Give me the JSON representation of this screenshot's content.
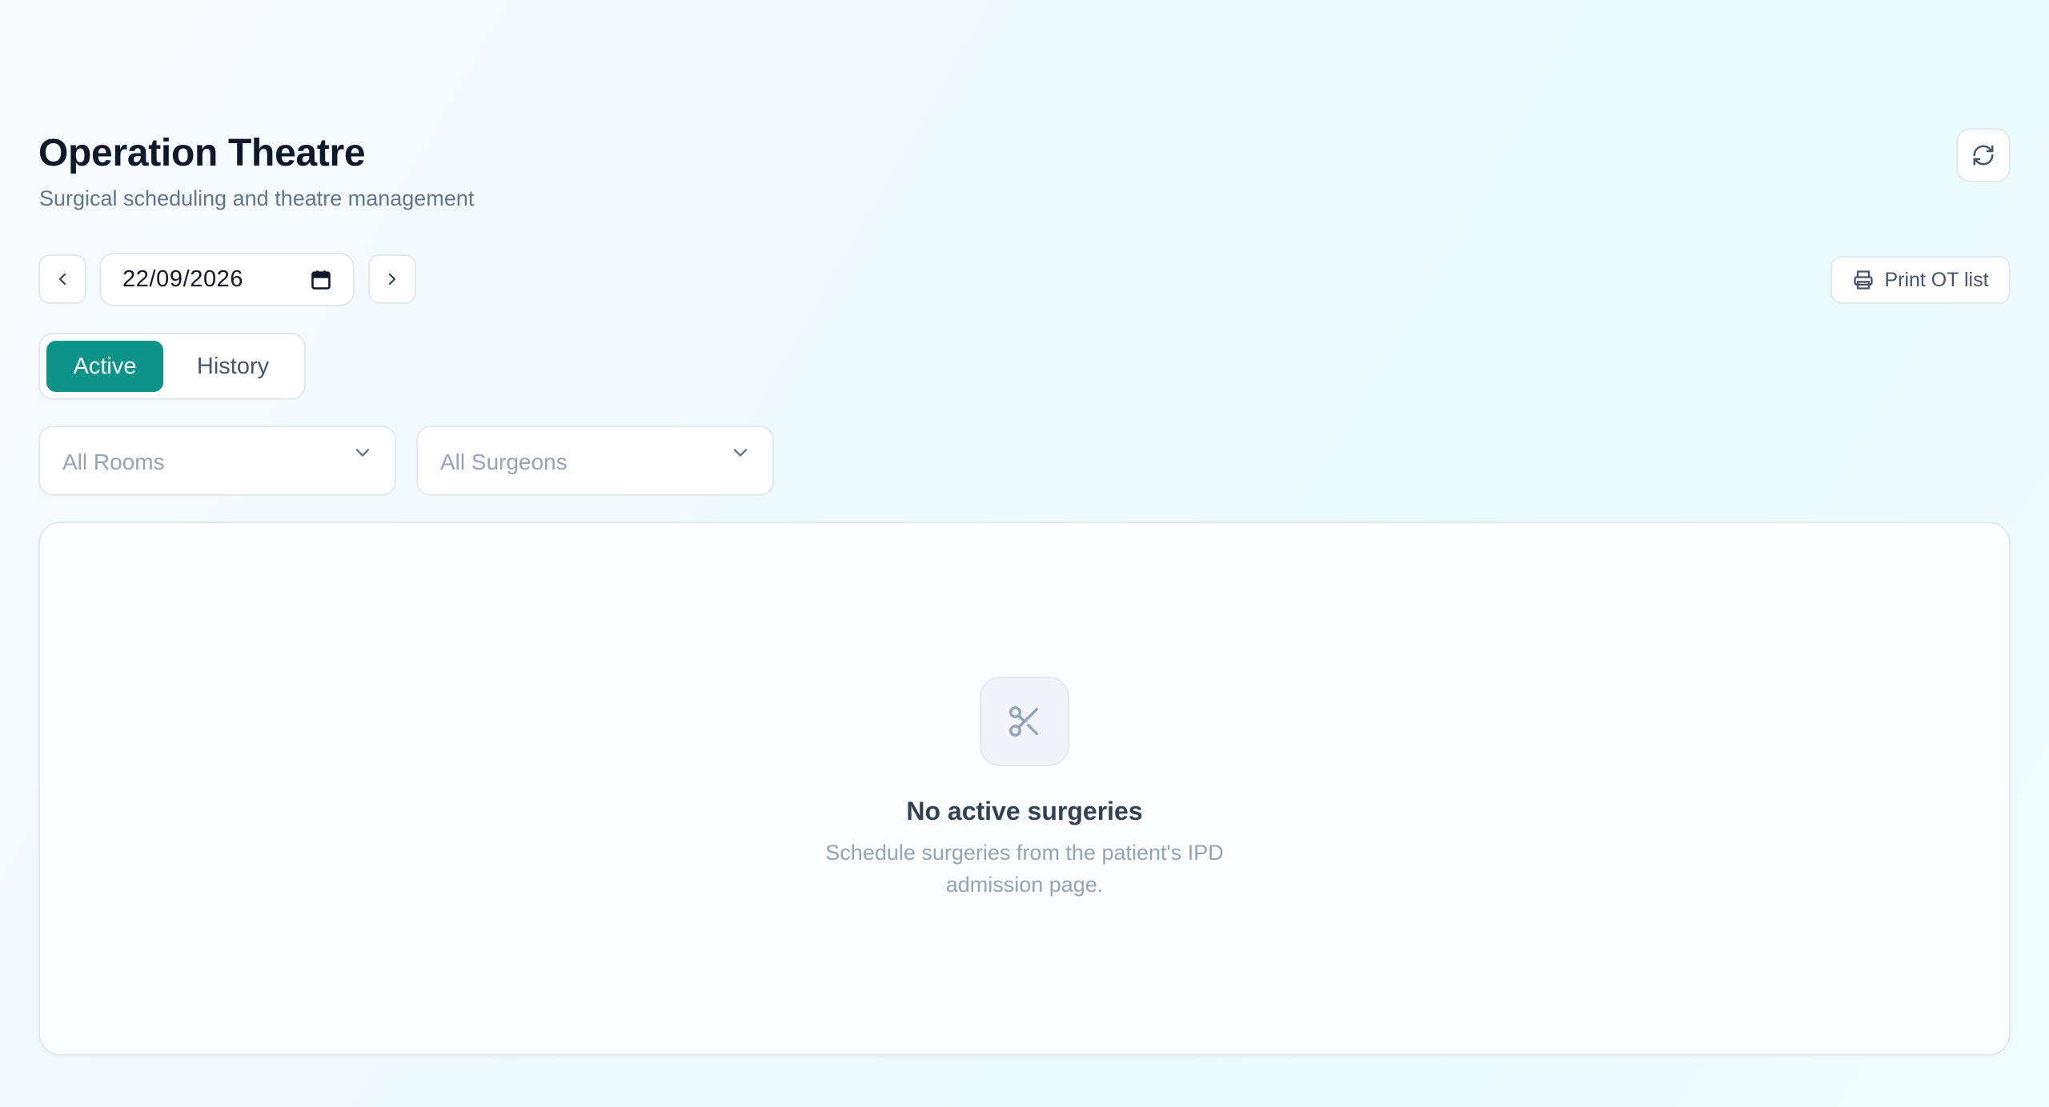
{
  "header": {
    "title": "Operation Theatre",
    "subtitle": "Surgical scheduling and theatre management",
    "refresh_icon": "refresh-icon"
  },
  "toolbar": {
    "date_value": "22/09/2026",
    "prev_icon": "chevron-left-icon",
    "next_icon": "chevron-right-icon",
    "calendar_icon": "calendar-icon",
    "print_label": "Print OT list",
    "print_icon": "printer-icon"
  },
  "tabs": [
    {
      "label": "Active",
      "selected": true
    },
    {
      "label": "History",
      "selected": false
    }
  ],
  "filters": {
    "rooms": {
      "value": "All Rooms"
    },
    "surgeons": {
      "value": "All Surgeons"
    }
  },
  "empty_state": {
    "icon": "scissors-icon",
    "title": "No active surgeries",
    "message": "Schedule surgeries from the patient's IPD admission page."
  },
  "colors": {
    "accent": "#0d9488",
    "title": "#0f172a",
    "muted": "#64748b",
    "border": "#e2e8f0",
    "placeholder": "#94a3b8"
  }
}
